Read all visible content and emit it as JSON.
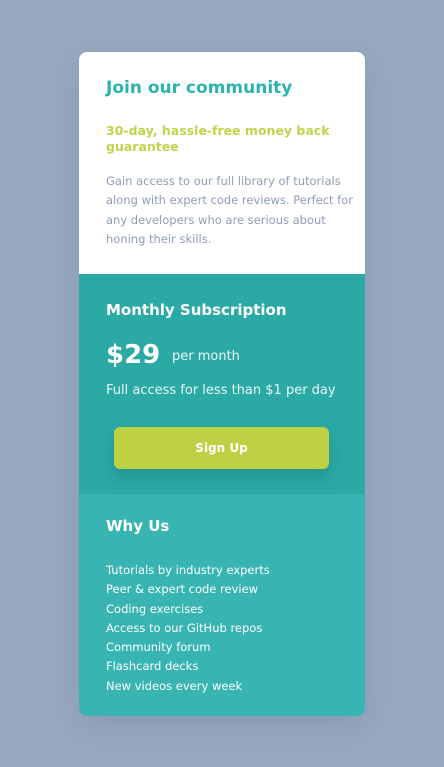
{
  "header": {
    "title": "Join our community",
    "subtitle": "30-day, hassle-free money back guarantee",
    "description": "Gain access to our full library of tutorials along with expert code reviews. Perfect for any developers who are serious about honing their skills."
  },
  "subscription": {
    "title": "Monthly Subscription",
    "price": "$29",
    "period": "per month",
    "tagline": "Full access for less than $1 per day",
    "button_label": "Sign Up"
  },
  "why_us": {
    "title": "Why Us",
    "items": [
      "Tutorials by industry experts",
      "Peer & expert code review",
      "Coding exercises",
      "Access to our GitHub repos",
      "Community forum",
      "Flashcard decks",
      "New videos every week"
    ]
  },
  "colors": {
    "background": "#97a8c0",
    "teal_heading": "#2bb3b1",
    "lime_accent": "#c0d34a",
    "teal_dark": "#2aa9a5",
    "teal_light": "#38b4b2",
    "body_text": "#8f9db3"
  }
}
